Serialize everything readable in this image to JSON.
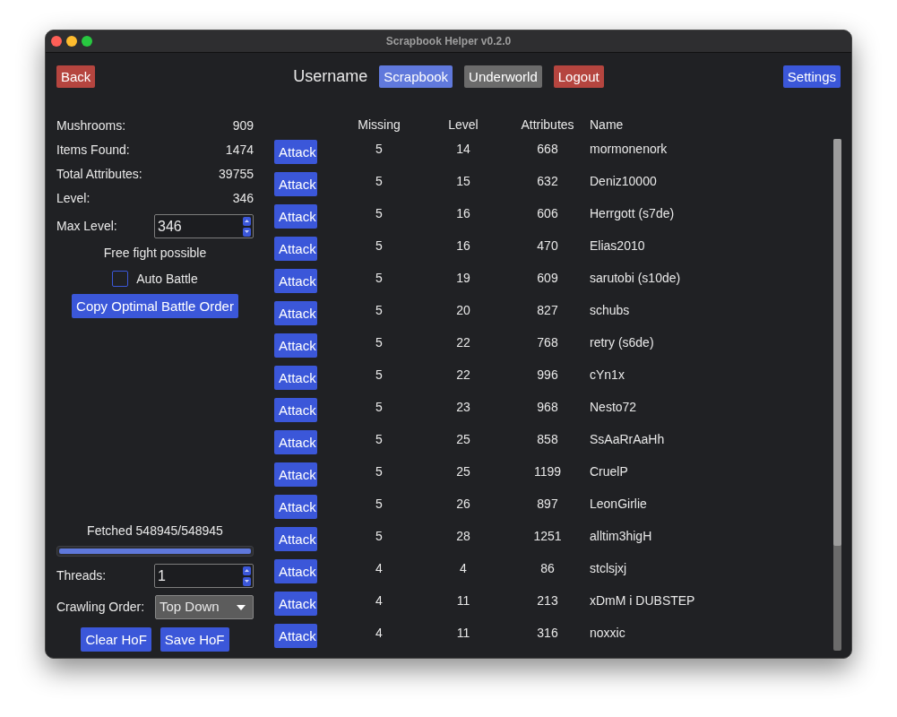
{
  "window": {
    "title": "Scrapbook Helper v0.2.0"
  },
  "header": {
    "back": {
      "label": "Back",
      "kind": "danger"
    },
    "username": "Username",
    "nav": [
      {
        "label": "Scrapbook",
        "kind": "primary",
        "disabled": true
      },
      {
        "label": "Underworld",
        "kind": "secondary",
        "disabled": false
      },
      {
        "label": "Logout",
        "kind": "danger",
        "disabled": false
      }
    ],
    "settings": {
      "label": "Settings",
      "kind": "primary"
    }
  },
  "stats": [
    {
      "label": "Mushrooms:",
      "value": "909"
    },
    {
      "label": "Items Found:",
      "value": "1474"
    },
    {
      "label": "Total Attributes:",
      "value": "39755"
    },
    {
      "label": "Level:",
      "value": "346"
    }
  ],
  "max_level": {
    "label": "Max Level:",
    "value": "346"
  },
  "status": "Free fight possible",
  "auto_battle": {
    "label": "Auto Battle",
    "checked": false
  },
  "copy_button": "Copy Optimal Battle Order",
  "fetch": {
    "text": "Fetched 548945/548945",
    "level": 1
  },
  "threads": {
    "label": "Threads:",
    "value": "1"
  },
  "crawling_order": {
    "label": "Crawling Order:",
    "value": "Top Down"
  },
  "hof_buttons": [
    "Clear HoF",
    "Save HoF"
  ],
  "table": {
    "columns": [
      "Missing",
      "Level",
      "Attributes",
      "Name"
    ],
    "rows": [
      {
        "action": "Attack",
        "cells": [
          "5",
          "14",
          "668",
          "mormonenork"
        ]
      },
      {
        "action": "Attack",
        "cells": [
          "5",
          "15",
          "632",
          "Deniz10000"
        ]
      },
      {
        "action": "Attack",
        "cells": [
          "5",
          "16",
          "606",
          "Herrgott (s7de)"
        ]
      },
      {
        "action": "Attack",
        "cells": [
          "5",
          "16",
          "470",
          "Elias2010"
        ]
      },
      {
        "action": "Attack",
        "cells": [
          "5",
          "19",
          "609",
          "sarutobi (s10de)"
        ]
      },
      {
        "action": "Attack",
        "cells": [
          "5",
          "20",
          "827",
          "schubs"
        ]
      },
      {
        "action": "Attack",
        "cells": [
          "5",
          "22",
          "768",
          "retry (s6de)"
        ]
      },
      {
        "action": "Attack",
        "cells": [
          "5",
          "22",
          "996",
          "cYn1x"
        ]
      },
      {
        "action": "Attack",
        "cells": [
          "5",
          "23",
          "968",
          "Nesto72"
        ]
      },
      {
        "action": "Attack",
        "cells": [
          "5",
          "25",
          "858",
          "SsAaRrAaHh"
        ]
      },
      {
        "action": "Attack",
        "cells": [
          "5",
          "25",
          "1199",
          "CruelP"
        ]
      },
      {
        "action": "Attack",
        "cells": [
          "5",
          "26",
          "897",
          "LeonGirlie"
        ]
      },
      {
        "action": "Attack",
        "cells": [
          "5",
          "28",
          "1251",
          "alltim3higH"
        ]
      },
      {
        "action": "Attack",
        "cells": [
          "4",
          "4",
          "86",
          "stclsjxj"
        ]
      },
      {
        "action": "Attack",
        "cells": [
          "4",
          "11",
          "213",
          "xDmM i DUBSTEP"
        ]
      },
      {
        "action": "Attack",
        "cells": [
          "4",
          "11",
          "316",
          "noxxic"
        ]
      }
    ]
  }
}
